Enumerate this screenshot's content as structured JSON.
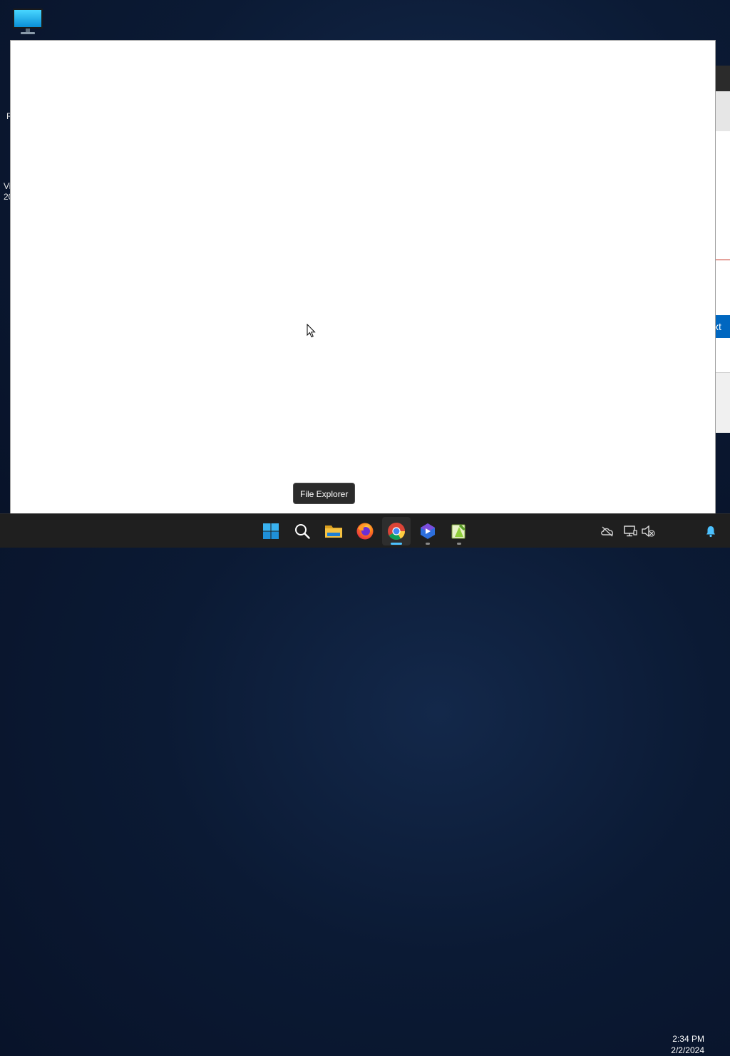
{
  "desktop": {
    "icons": [
      {
        "name": "This PC",
        "icon": "monitor-icon"
      }
    ],
    "peek_texts": [
      "R",
      "Vi",
      "20"
    ]
  },
  "background_window": {
    "button_partial_label": "xt",
    "colors": {
      "accent": "#0067c0",
      "error_line": "#c42b1c",
      "titlebar": "#2b2b2b"
    }
  },
  "tooltip": {
    "text": "File Explorer"
  },
  "taskbar": {
    "items": [
      {
        "name": "Start",
        "icon": "windows-start-icon"
      },
      {
        "name": "Search",
        "icon": "search-icon"
      },
      {
        "name": "File Explorer",
        "icon": "folder-icon"
      },
      {
        "name": "Firefox",
        "icon": "firefox-icon"
      },
      {
        "name": "Google Chrome",
        "icon": "chrome-icon",
        "active": true
      },
      {
        "name": "Power Automate",
        "icon": "power-automate-icon",
        "running": true
      },
      {
        "name": "Notepad++",
        "icon": "notepadpp-icon",
        "running": true
      }
    ],
    "tray": {
      "icons": [
        "onedrive-offline-icon",
        "network-icon",
        "volume-muted-icon",
        "notification-bell-icon"
      ],
      "time": "2:34 PM",
      "date": "2/2/2024"
    }
  }
}
